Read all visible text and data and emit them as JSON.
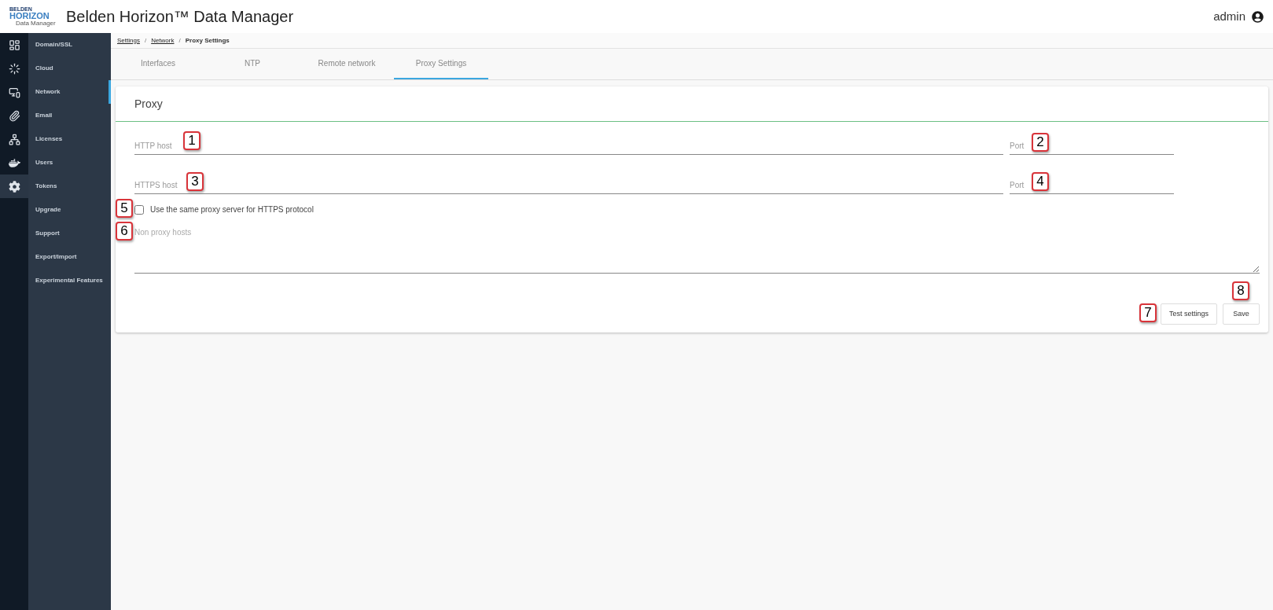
{
  "header": {
    "logo": {
      "line_1": "BELDEN",
      "line_2": "HORIZON",
      "line_3": "Data Manager"
    },
    "title": "Belden Horizon™ Data Manager",
    "user": "admin"
  },
  "rail": [
    {
      "kind": "dashboard",
      "selected": false
    },
    {
      "kind": "cycle",
      "selected": false
    },
    {
      "kind": "devices",
      "selected": false
    },
    {
      "kind": "attachment",
      "selected": false
    },
    {
      "kind": "nodes",
      "selected": false
    },
    {
      "kind": "docker",
      "selected": false
    },
    {
      "kind": "settings",
      "selected": true
    }
  ],
  "submenu": [
    {
      "label": "Domain/SSL",
      "selected": false
    },
    {
      "label": "Cloud",
      "selected": false
    },
    {
      "label": "Network",
      "selected": true
    },
    {
      "label": "Email",
      "selected": false
    },
    {
      "label": "Licenses",
      "selected": false
    },
    {
      "label": "Users",
      "selected": false
    },
    {
      "label": "Tokens",
      "selected": false
    },
    {
      "label": "Upgrade",
      "selected": false
    },
    {
      "label": "Support",
      "selected": false
    },
    {
      "label": "Export/Import",
      "selected": false
    },
    {
      "label": "Experimental Features",
      "selected": false
    }
  ],
  "breadcrumb": {
    "separator": "/",
    "items": [
      {
        "label": "Settings",
        "link": true
      },
      {
        "label": "Network",
        "link": true
      },
      {
        "label": "Proxy Settings",
        "link": false
      }
    ]
  },
  "tabs": [
    {
      "label": "Interfaces",
      "selected": false
    },
    {
      "label": "NTP",
      "selected": false
    },
    {
      "label": "Remote network",
      "selected": false
    },
    {
      "label": "Proxy Settings",
      "selected": true
    }
  ],
  "card": {
    "title": "Proxy",
    "rows": [
      {
        "host_placeholder": "HTTP host",
        "host_callout": "1",
        "port_placeholder": "Port",
        "port_callout": "2"
      },
      {
        "host_placeholder": "HTTPS host",
        "host_callout": "3",
        "port_placeholder": "Port",
        "port_callout": "4"
      }
    ],
    "same_proxy": {
      "label": "Use the same proxy server for HTTPS protocol",
      "checked": false,
      "callout": "5"
    },
    "non_proxy": {
      "placeholder": "Non proxy hosts",
      "callout": "6"
    },
    "buttons": [
      {
        "label": "Test settings",
        "callout": "7"
      },
      {
        "label": "Save",
        "callout": "8"
      }
    ]
  }
}
